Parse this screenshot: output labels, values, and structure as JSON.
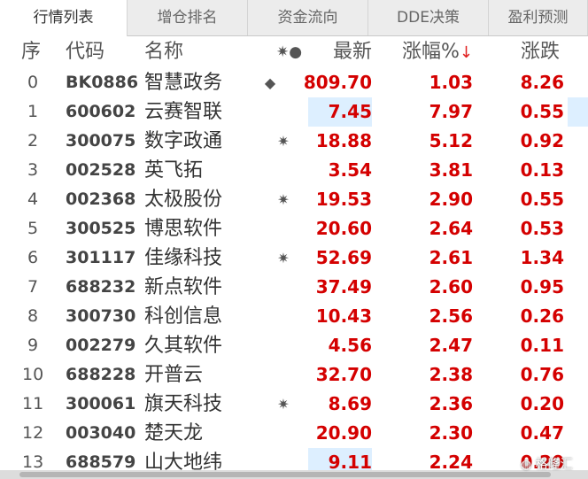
{
  "tabs": [
    "行情列表",
    "增仓排名",
    "资金流向",
    "DDE决策",
    "盈利预测"
  ],
  "columns": {
    "idx": "序",
    "code": "代码",
    "name": "名称",
    "mark_icons": "✷●",
    "price": "最新",
    "change_pct": "涨幅%",
    "sort_arrow": "↓",
    "change": "涨跌"
  },
  "rows": [
    {
      "idx": "0",
      "code": "BK0886",
      "name": "智慧政务",
      "mark": "◆",
      "price": "809.70",
      "change_pct": "1.03",
      "change": "8.26"
    },
    {
      "idx": "1",
      "code": "600602",
      "name": "云赛智联",
      "mark": "",
      "price": "7.45",
      "change_pct": "7.97",
      "change": "0.55"
    },
    {
      "idx": "2",
      "code": "300075",
      "name": "数字政通",
      "mark": "✷",
      "price": "18.88",
      "change_pct": "5.12",
      "change": "0.92"
    },
    {
      "idx": "3",
      "code": "002528",
      "name": "英飞拓",
      "mark": "",
      "price": "3.54",
      "change_pct": "3.81",
      "change": "0.13"
    },
    {
      "idx": "4",
      "code": "002368",
      "name": "太极股份",
      "mark": "✷",
      "price": "19.53",
      "change_pct": "2.90",
      "change": "0.55"
    },
    {
      "idx": "5",
      "code": "300525",
      "name": "博思软件",
      "mark": "",
      "price": "20.60",
      "change_pct": "2.64",
      "change": "0.53"
    },
    {
      "idx": "6",
      "code": "301117",
      "name": "佳缘科技",
      "mark": "✷",
      "price": "52.69",
      "change_pct": "2.61",
      "change": "1.34"
    },
    {
      "idx": "7",
      "code": "688232",
      "name": "新点软件",
      "mark": "",
      "price": "37.49",
      "change_pct": "2.60",
      "change": "0.95"
    },
    {
      "idx": "8",
      "code": "300730",
      "name": "科创信息",
      "mark": "",
      "price": "10.43",
      "change_pct": "2.56",
      "change": "0.26"
    },
    {
      "idx": "9",
      "code": "002279",
      "name": "久其软件",
      "mark": "",
      "price": "4.56",
      "change_pct": "2.47",
      "change": "0.11"
    },
    {
      "idx": "10",
      "code": "688228",
      "name": "开普云",
      "mark": "",
      "price": "32.70",
      "change_pct": "2.38",
      "change": "0.76"
    },
    {
      "idx": "11",
      "code": "300061",
      "name": "旗天科技",
      "mark": "✷",
      "price": "8.69",
      "change_pct": "2.36",
      "change": "0.20"
    },
    {
      "idx": "12",
      "code": "003040",
      "name": "楚天龙",
      "mark": "",
      "price": "20.90",
      "change_pct": "2.30",
      "change": "0.47"
    },
    {
      "idx": "13",
      "code": "688579",
      "name": "山大地纬",
      "mark": "",
      "price": "9.11",
      "change_pct": "2.24",
      "change": "0.20"
    }
  ],
  "watermark": "格隆汇",
  "colors": {
    "up": "#d40000",
    "highlight": "#ddefff",
    "tab_bg": "#ececec"
  }
}
